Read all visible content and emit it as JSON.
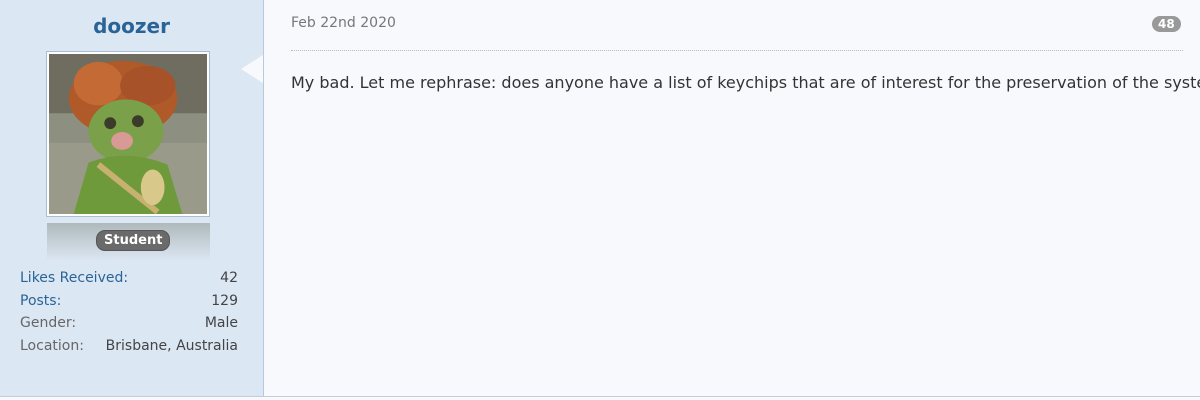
{
  "user": {
    "name": "doozer",
    "rank": "Student",
    "avatar_icon": "puppet-avatar"
  },
  "stats": [
    {
      "label": "Likes Received:",
      "value": "42",
      "link": true
    },
    {
      "label": "Posts:",
      "value": "129",
      "link": true
    },
    {
      "label": "Gender:",
      "value": "Male",
      "link": false
    },
    {
      "label": "Location:",
      "value": "Brisbane, Australia",
      "link": false
    }
  ],
  "post": {
    "date": "Feb 22nd 2020",
    "number": "48",
    "message": "My bad. Let me rephrase: does anyone have a list of keychips that are of interest for the preservation of the systems?"
  },
  "colors": {
    "sidebar_bg": "#dce7f4",
    "username": "#2a6496",
    "post_bg": "#f8f9fd"
  }
}
